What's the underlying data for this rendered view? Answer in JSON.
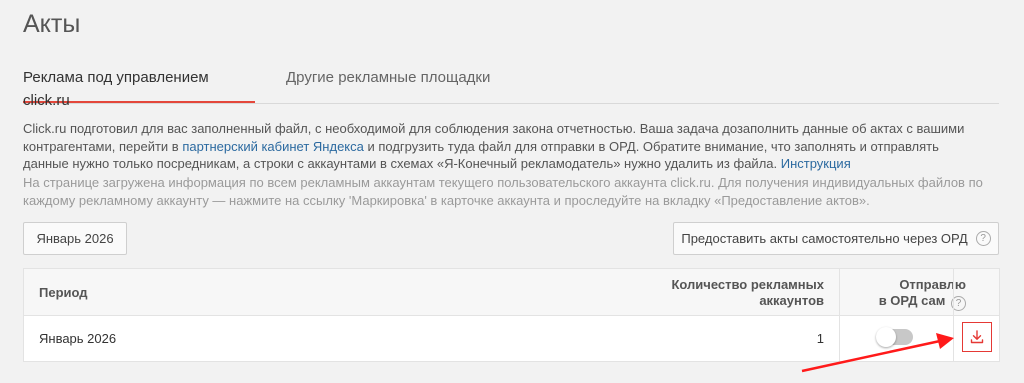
{
  "page": {
    "title": "Акты"
  },
  "tabs": [
    {
      "label": "Реклама под управлением click.ru",
      "active": true
    },
    {
      "label": "Другие рекламные площадки",
      "active": false
    }
  ],
  "description": {
    "part1": "Click.ru подготовил для вас заполненный файл, с необходимой для соблюдения закона отчетностью. Ваша задача дозаполнить данные об актах с вашими контрагентами, перейти в ",
    "link1": "партнерский кабинет Яндекса",
    "part2": " и подгрузить туда файл для отправки в ОРД. Обратите внимание, что заполнять и отправлять данные нужно только посредникам, а строки с аккаунтами в схемах «Я-Конечный рекламодатель» нужно удалить из файла. ",
    "link2": "Инструкция"
  },
  "note": "На странице загружена информация по всем рекламным аккаунтам текущего пользовательского аккаунта click.ru. Для получения индивидуальных файлов по каждому рекламному аккаунту — нажмите на ссылку 'Маркировка' в карточке аккаунта и проследуйте на вкладку «Предоставление актов».",
  "toolbar": {
    "month_label": "Январь 2026",
    "ord_button_label": "Предоставить акты самостоятельно через ОРД",
    "help_glyph": "?"
  },
  "table": {
    "headers": {
      "period": "Период",
      "count_line1": "Количество рекламных",
      "count_line2": "аккаунтов",
      "ord_line1": "Отправлю",
      "ord_line2": "в ОРД сам"
    },
    "rows": [
      {
        "period": "Январь 2026",
        "count": "1",
        "send_self": false
      }
    ]
  },
  "colors": {
    "accent": "#e4473b",
    "link": "#2c6aa0",
    "download": "#e53935"
  },
  "icons": [
    "help-circle-icon",
    "download-icon",
    "annotation-arrow"
  ]
}
